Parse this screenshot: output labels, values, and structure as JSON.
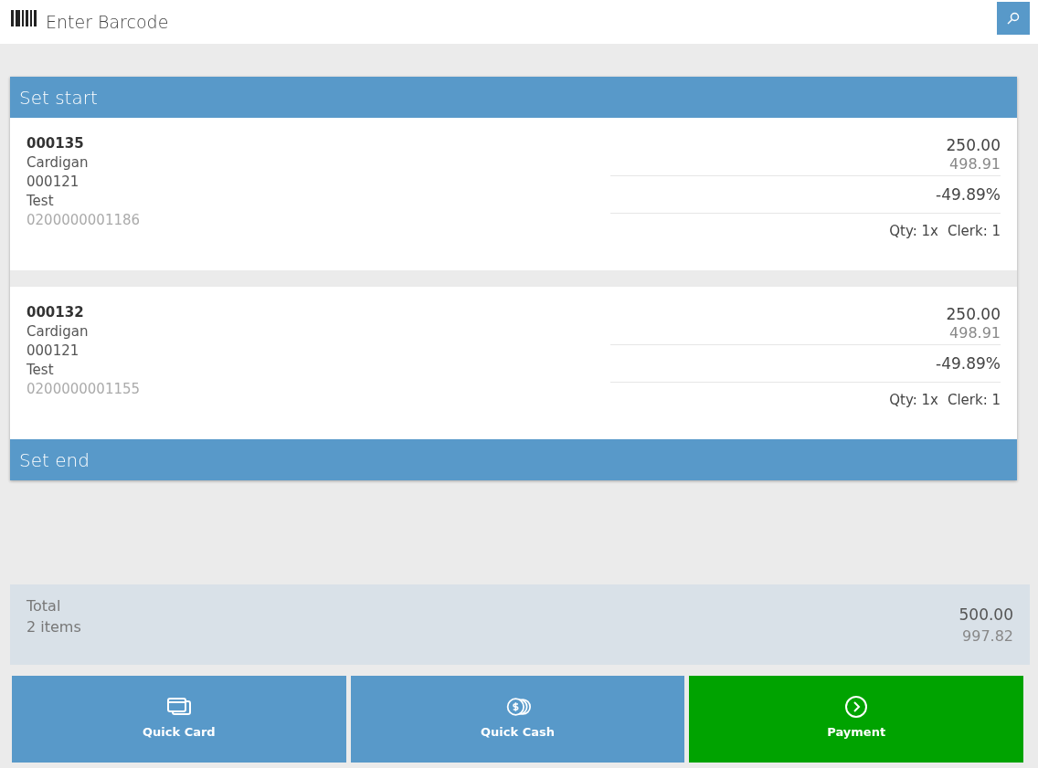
{
  "search_bar": {
    "placeholder": "Enter Barcode"
  },
  "set": {
    "start_label": "Set start",
    "end_label": "Set end",
    "items": [
      {
        "code": "000135",
        "name": "Cardigan",
        "ref": "000121",
        "note": "Test",
        "barcode": "0200000001186",
        "price": "250.00",
        "original_price": "498.91",
        "discount": "-49.89%",
        "qty": "Qty: 1x",
        "clerk": "Clerk: 1"
      },
      {
        "code": "000132",
        "name": "Cardigan",
        "ref": "000121",
        "note": "Test",
        "barcode": "0200000001155",
        "price": "250.00",
        "original_price": "498.91",
        "discount": "-49.89%",
        "qty": "Qty: 1x",
        "clerk": "Clerk: 1"
      }
    ]
  },
  "total": {
    "label": "Total",
    "count": "2 items",
    "amount": "500.00",
    "original_amount": "997.82"
  },
  "actions": [
    {
      "kind": "card",
      "label": "Quick Card",
      "color": "#5899c9"
    },
    {
      "kind": "cash",
      "label": "Quick Cash",
      "color": "#5899c9"
    },
    {
      "kind": "payment",
      "label": "Payment",
      "color": "#00a300"
    }
  ]
}
